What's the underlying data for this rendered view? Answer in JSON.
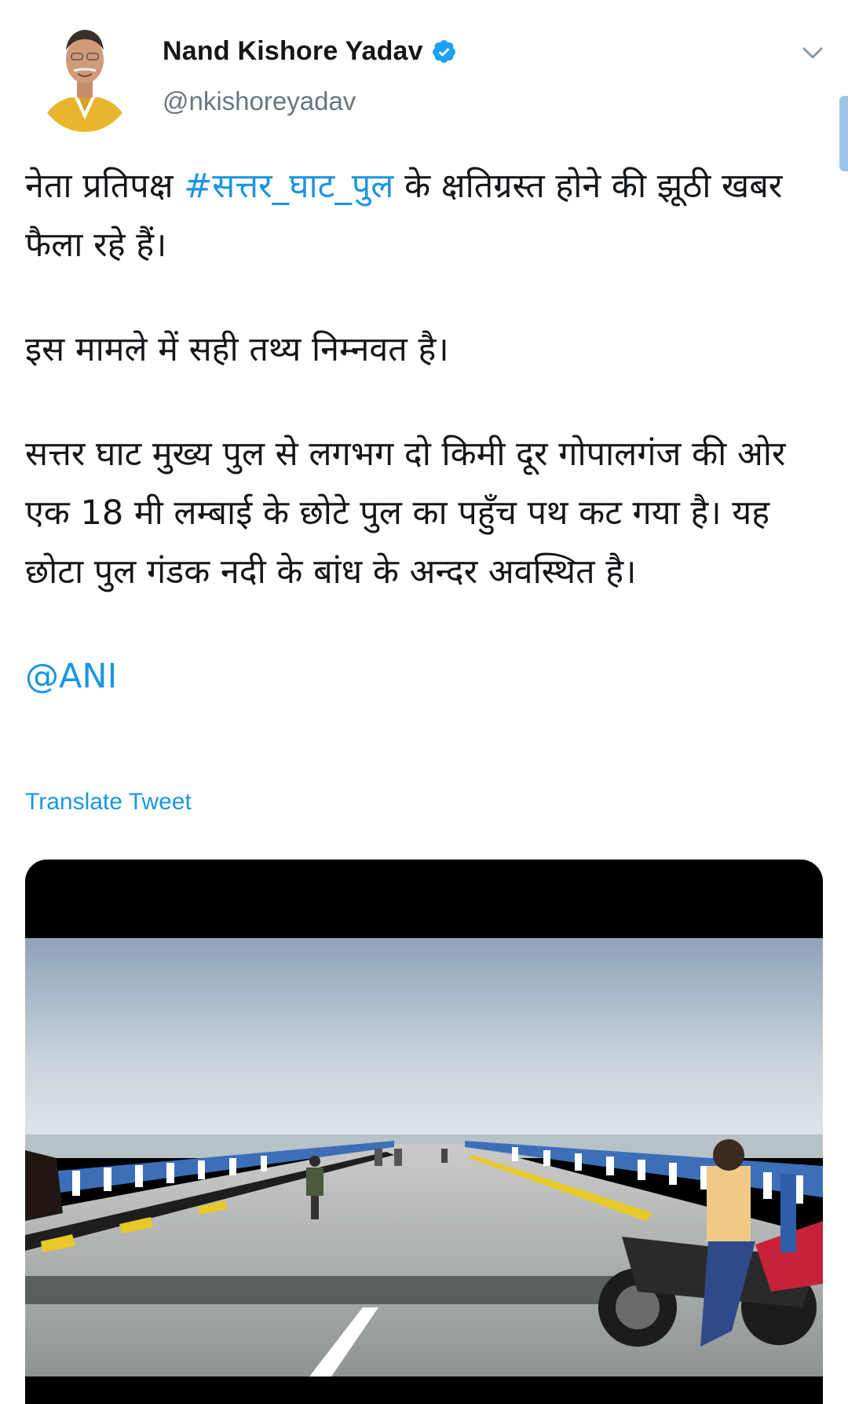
{
  "tweet": {
    "author": {
      "display_name": "Nand Kishore Yadav",
      "handle": "@nkishoreyadav",
      "verified": true,
      "avatar_icon": "avatar-photo"
    },
    "menu_icon": "chevron-down-icon",
    "text": {
      "line1_prefix": "नेता प्रतिपक्ष ",
      "hashtag": "#सत्तर_घाट_पुल",
      "line1_suffix": " के क्षतिग्रस्त होने की झूठी खबर फैला रहे हैं।",
      "paragraph2": "इस मामले में सही तथ्य निम्नवत है।",
      "paragraph3": "सत्तर घाट मुख्य पुल से लगभग दो किमी दूर गोपालगंज की ओर एक 18 मी लम्बाई के छोटे पुल का पहुँच पथ कट गया है। यह छोटा पुल गंडक नदी के बांध के अन्दर अवस्थित है।",
      "mention": "@ANI"
    },
    "translate_label": "Translate Tweet",
    "media": {
      "type": "video",
      "thumbnail_icon": "bridge-video-thumbnail"
    }
  },
  "colors": {
    "link": "#1b95e0",
    "text": "#14171a",
    "secondary": "#657786",
    "verified": "#1da1f2",
    "scrollbar": "#9fc6e8"
  }
}
